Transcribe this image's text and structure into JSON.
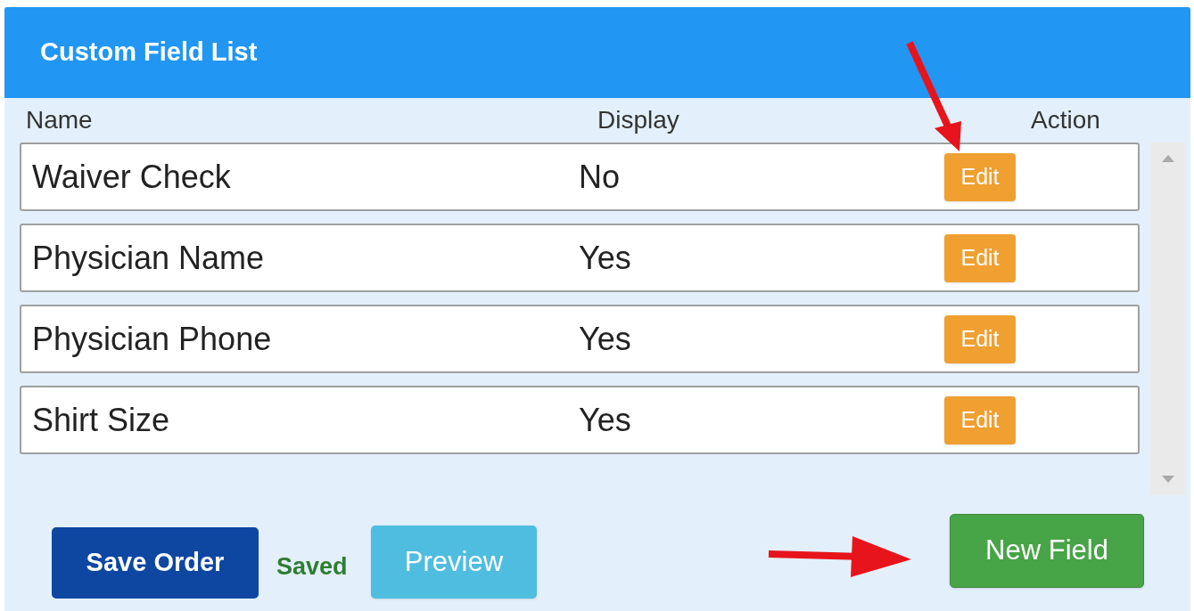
{
  "panel": {
    "title": "Custom Field List"
  },
  "table": {
    "columns": [
      "Name",
      "Display",
      "Action"
    ],
    "rows": [
      {
        "name": "Waiver Check",
        "display": "No",
        "action": "Edit"
      },
      {
        "name": "Physician Name",
        "display": "Yes",
        "action": "Edit"
      },
      {
        "name": "Physician Phone",
        "display": "Yes",
        "action": "Edit"
      },
      {
        "name": "Shirt Size",
        "display": "Yes",
        "action": "Edit"
      }
    ]
  },
  "footer": {
    "save_button": "Save Order",
    "status": "Saved",
    "preview_button": "Preview",
    "new_button": "New Field"
  }
}
